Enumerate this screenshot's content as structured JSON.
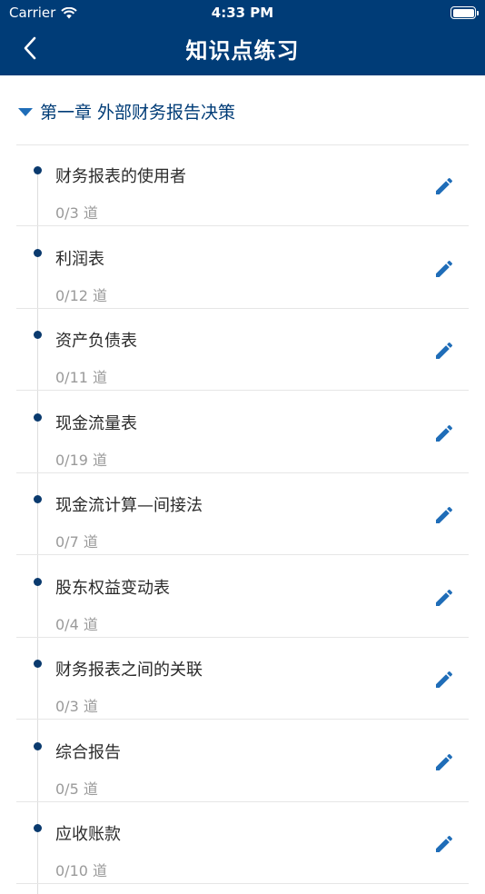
{
  "status_bar": {
    "carrier": "Carrier",
    "time": "4:33 PM"
  },
  "nav": {
    "title": "知识点练习"
  },
  "chapter": {
    "label": "第一章 外部财务报告决策"
  },
  "items": [
    {
      "name": "财务报表的使用者",
      "count": "0/3  道"
    },
    {
      "name": "利润表",
      "count": "0/12  道"
    },
    {
      "name": "资产负债表",
      "count": "0/11  道"
    },
    {
      "name": "现金流量表",
      "count": "0/19  道"
    },
    {
      "name": "现金流计算—间接法",
      "count": "0/7  道"
    },
    {
      "name": "股东权益变动表",
      "count": "0/4  道"
    },
    {
      "name": "财务报表之间的关联",
      "count": "0/3  道"
    },
    {
      "name": "综合报告",
      "count": "0/5  道"
    },
    {
      "name": "应收账款",
      "count": "0/10  道"
    }
  ],
  "colors": {
    "header_bg": "#003c77",
    "accent": "#1f6db8",
    "dot": "#0a3a6e"
  }
}
